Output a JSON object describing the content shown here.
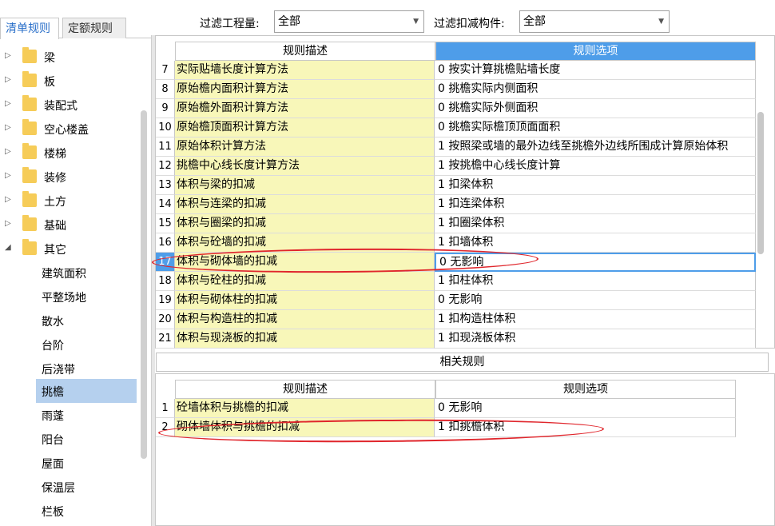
{
  "tabs": [
    {
      "label": "清单规则",
      "active": true
    },
    {
      "label": "定额规则",
      "active": false
    }
  ],
  "filters": {
    "quantity_label": "过滤工程量:",
    "quantity_value": "全部",
    "component_label": "过滤扣减构件:",
    "component_value": "全部"
  },
  "tree": {
    "folders": [
      {
        "label": "梁",
        "expander": "▷"
      },
      {
        "label": "板",
        "expander": "▷"
      },
      {
        "label": "装配式",
        "expander": "▷"
      },
      {
        "label": "空心楼盖",
        "expander": "▷"
      },
      {
        "label": "楼梯",
        "expander": "▷"
      },
      {
        "label": "装修",
        "expander": "▷"
      },
      {
        "label": "土方",
        "expander": "▷"
      },
      {
        "label": "基础",
        "expander": "▷"
      },
      {
        "label": "其它",
        "expander": "◢"
      }
    ],
    "leaves": [
      {
        "label": "建筑面积"
      },
      {
        "label": "平整场地"
      },
      {
        "label": "散水"
      },
      {
        "label": "台阶"
      },
      {
        "label": "后浇带"
      },
      {
        "label": "挑檐",
        "selected": true
      },
      {
        "label": "雨蓬"
      },
      {
        "label": "阳台"
      },
      {
        "label": "屋面"
      },
      {
        "label": "保温层"
      },
      {
        "label": "栏板"
      }
    ]
  },
  "rules_table": {
    "headers": {
      "desc": "规则描述",
      "option": "规则选项"
    },
    "rows": [
      {
        "num": "7",
        "desc": "实际贴墙长度计算方法",
        "option": "0   按实计算挑檐贴墙长度"
      },
      {
        "num": "8",
        "desc": "原始檐内面积计算方法",
        "option": "0  挑檐实际内侧面积"
      },
      {
        "num": "9",
        "desc": "原始檐外面积计算方法",
        "option": "0  挑檐实际外侧面积"
      },
      {
        "num": "10",
        "desc": "原始檐顶面积计算方法",
        "option": "0  挑檐实际檐顶顶面面积"
      },
      {
        "num": "11",
        "desc": "原始体积计算方法",
        "option": "1  按照梁或墙的最外边线至挑檐外边线所围成计算原始体积"
      },
      {
        "num": "12",
        "desc": "挑檐中心线长度计算方法",
        "option": "1    按挑檐中心线长度计算"
      },
      {
        "num": "13",
        "desc": "体积与梁的扣减",
        "option": "1  扣梁体积"
      },
      {
        "num": "14",
        "desc": "体积与连梁的扣减",
        "option": "1  扣连梁体积"
      },
      {
        "num": "15",
        "desc": "体积与圈梁的扣减",
        "option": "1  扣圈梁体积"
      },
      {
        "num": "16",
        "desc": "体积与砼墙的扣减",
        "option": "1  扣墙体积"
      },
      {
        "num": "17",
        "desc": "体积与砌体墙的扣减",
        "option": "0   无影响",
        "active": true
      },
      {
        "num": "18",
        "desc": "体积与砼柱的扣减",
        "option": "1  扣柱体积"
      },
      {
        "num": "19",
        "desc": "体积与砌体柱的扣减",
        "option": "0   无影响"
      },
      {
        "num": "20",
        "desc": "体积与构造柱的扣减",
        "option": "1  扣构造柱体积"
      },
      {
        "num": "21",
        "desc": "体积与现浇板的扣减",
        "option": "1  扣现浇板体积"
      }
    ]
  },
  "related": {
    "title": "相关规则",
    "headers": {
      "desc": "规则描述",
      "option": "规则选项"
    },
    "rows": [
      {
        "num": "1",
        "desc": "砼墙体积与挑檐的扣减",
        "option": "0   无影响"
      },
      {
        "num": "2",
        "desc": "砌体墙体积与挑檐的扣减",
        "option": "1  扣挑檐体积"
      }
    ]
  },
  "colors": {
    "accent": "#4e9de9",
    "desc_bg": "#f8f7b9",
    "folder": "#f6cc58",
    "annotation": "#e0262c"
  }
}
